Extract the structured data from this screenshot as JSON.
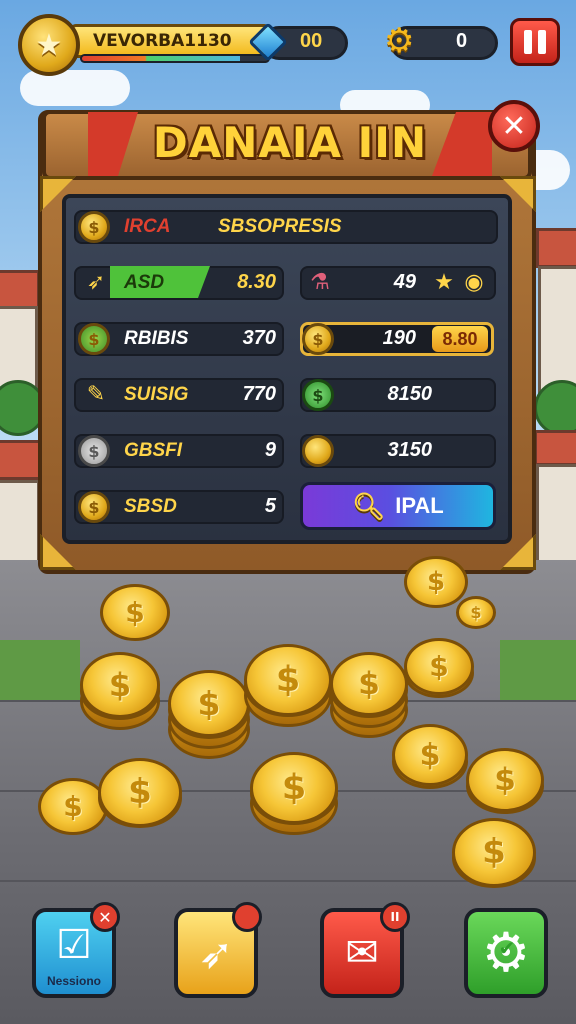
{
  "hud": {
    "player_name": "VEVORBA1130",
    "xp_fraction": 0.85,
    "gems": "00",
    "coins": "0"
  },
  "panel": {
    "title": "DANAIA IIN",
    "header_row": {
      "label": "IRCA",
      "value": "SBSOPRESIS"
    },
    "left_rows": [
      {
        "icon": "coin-icon",
        "label": "",
        "value": ""
      },
      {
        "icon": "bullet-icon",
        "label": "ASD",
        "value": "8.30"
      },
      {
        "icon": "coin-icon",
        "label": "RBIBIS",
        "value": "370"
      },
      {
        "icon": "scroll-icon",
        "label": "SUISIG",
        "value": "770"
      },
      {
        "icon": "coin-icon",
        "label": "GBSFI",
        "value": "9"
      },
      {
        "icon": "coin-icon",
        "label": "SBSD",
        "value": "5"
      }
    ],
    "right_rows": [
      {
        "icon": "potion-icon",
        "value": "49",
        "extra": "star-icon"
      },
      {
        "icon": "coin-icon",
        "value": "190",
        "chip": "8.80"
      },
      {
        "icon": "green-coin-icon",
        "value": "8150"
      },
      {
        "icon": "gold-coin-icon",
        "value": "3150"
      }
    ],
    "action_button": "IPAL"
  },
  "bottom_bar": {
    "button_1_caption": "Nessiono",
    "button_1_badge": "✕",
    "button_2_badge": "",
    "button_3_badge": "II",
    "button_4_badge": "✔"
  },
  "colors": {
    "gold": "#ffd54a",
    "wood": "#b47a3c",
    "screen": "#2a3140",
    "red_button": "#c4231a",
    "green_button": "#3fb03a",
    "blue_button": "#1fa6e0",
    "purple_button": "#7a3ad8"
  }
}
